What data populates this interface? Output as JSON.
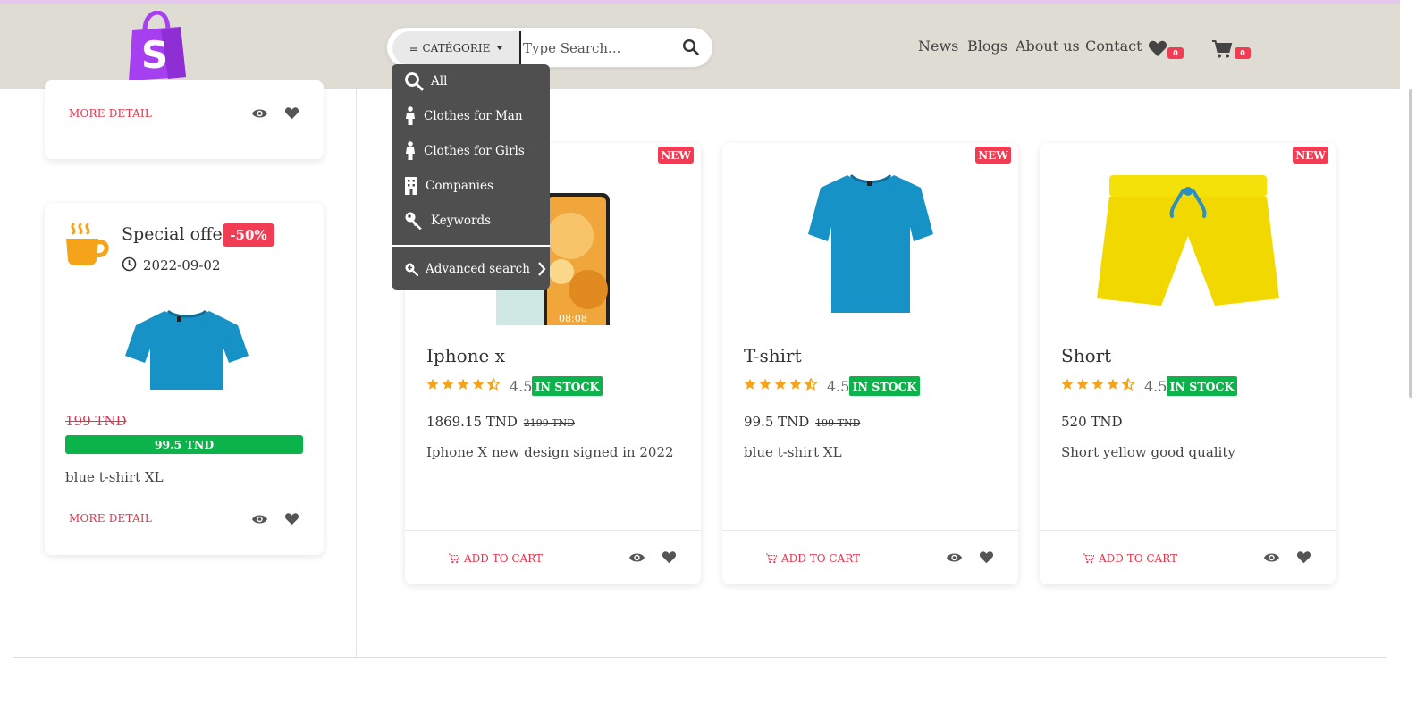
{
  "colors": {
    "accent": "#f03d54",
    "green": "#0cb34a",
    "header_bg": "#dedcd3",
    "logo": "#a63ff0",
    "star": "#f5a41a"
  },
  "search": {
    "category_label": "CATÉGORIE",
    "placeholder": "Type Search..."
  },
  "nav": {
    "news": "News",
    "blogs": "Blogs",
    "about": "About us",
    "contact": "Contact",
    "wishlist_count": "0",
    "cart_count": "0"
  },
  "dropdown": {
    "items": [
      {
        "label": "All",
        "icon": "search-icon"
      },
      {
        "label": "Clothes for Man",
        "icon": "person-icon"
      },
      {
        "label": "Clothes for Girls",
        "icon": "person-icon"
      },
      {
        "label": "Companies",
        "icon": "building-icon"
      },
      {
        "label": "Keywords",
        "icon": "key-icon"
      }
    ],
    "advanced": "Advanced search"
  },
  "sidebar": {
    "top_card": {
      "more": "MORE DETAIL"
    },
    "offer": {
      "title": "Special offer",
      "badge": "-50%",
      "date": "2022-09-02",
      "old_price": "199 TND",
      "new_price": "99.5 TND",
      "desc": "blue t-shirt XL",
      "more": "MORE DETAIL"
    }
  },
  "products": [
    {
      "name": "Iphone x",
      "badge": "NEW",
      "rating": "4.5",
      "stars": 4.5,
      "stock": "IN STOCK",
      "price": "1869.15 TND",
      "old_price": "2199 TND",
      "desc": "Iphone X new design signed in 2022",
      "cta": "ADD TO CART"
    },
    {
      "name": "T-shirt",
      "badge": "NEW",
      "rating": "4.5",
      "stars": 4.5,
      "stock": "IN STOCK",
      "price": "99.5 TND",
      "old_price": "199 TND",
      "desc": "blue t-shirt XL",
      "cta": "ADD TO CART"
    },
    {
      "name": "Short",
      "badge": "NEW",
      "rating": "4.5",
      "stars": 4.5,
      "stock": "IN STOCK",
      "price": "520 TND",
      "old_price": "",
      "desc": "Short yellow good quality",
      "cta": "ADD TO CART"
    }
  ]
}
